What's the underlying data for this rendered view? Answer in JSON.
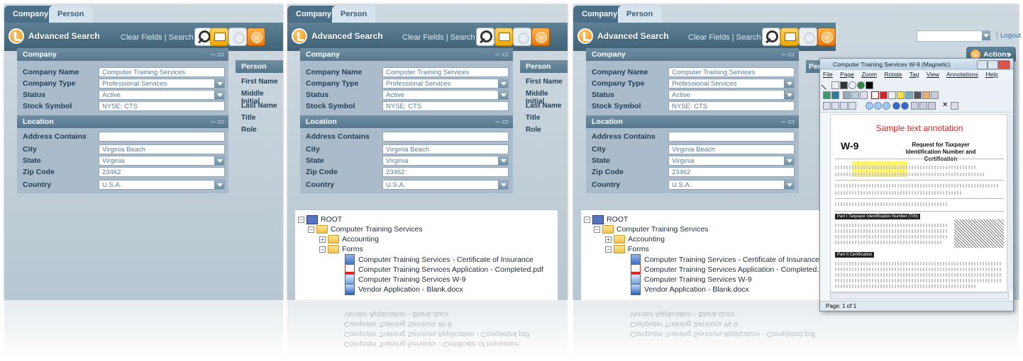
{
  "tabs": {
    "company": "Company",
    "person": "Person"
  },
  "toolbar": {
    "title": "Advanced Search",
    "clear_fields": "Clear Fields",
    "separator": "|",
    "search": "Search"
  },
  "company_section": {
    "header": "Company",
    "controls": "– ▭",
    "fields": [
      {
        "label": "Company Name",
        "value": "Computer Training Services"
      },
      {
        "label": "Company Type",
        "value": "Professional Services"
      },
      {
        "label": "Status",
        "value": "Active"
      },
      {
        "label": "Stock Symbol",
        "value": "NYSE: CTS"
      }
    ]
  },
  "location_section": {
    "header": "Location",
    "controls": "– ▭",
    "fields": [
      {
        "label": "Address Contains",
        "value": ""
      },
      {
        "label": "City",
        "value": "Virginia Beach"
      },
      {
        "label": "State",
        "value": "Virginia"
      },
      {
        "label": "Zip Code",
        "value": "23462"
      },
      {
        "label": "Country",
        "value": "U.S.A."
      }
    ]
  },
  "person_section": {
    "header": "Person",
    "items": [
      "First Name",
      "Middle Initial",
      "Last Name",
      "Title",
      "Role"
    ]
  },
  "tree": {
    "root": "ROOT",
    "company": "Computer Training Services",
    "accounting": "Accounting",
    "forms": "Forms",
    "files": [
      "Computer Training Services - Certificate of Insurance",
      "Computer Training Services Application - Completed.pdf",
      "Computer Training Services W-9",
      "Vendor Application - Blank.docx"
    ]
  },
  "topbar": {
    "separator": "|",
    "logout": "Logout",
    "actions": "Actions"
  },
  "viewer": {
    "title": "Computer Training Services W-9 (Magnetic)",
    "menu": [
      "File",
      "Page",
      "Zoom",
      "Rotate",
      "Tag",
      "View",
      "Annotations",
      "Help"
    ],
    "annotation": "Sample text annotation",
    "form_name": "W-9",
    "form_heading": "Request for Taxpayer Identification Number and Certification",
    "part1": "Part I",
    "part1_title": "Taxpayer Identification Number (TIN)",
    "part2": "Part II",
    "part2_title": "Certification",
    "status": "Page: 1 of 1"
  }
}
